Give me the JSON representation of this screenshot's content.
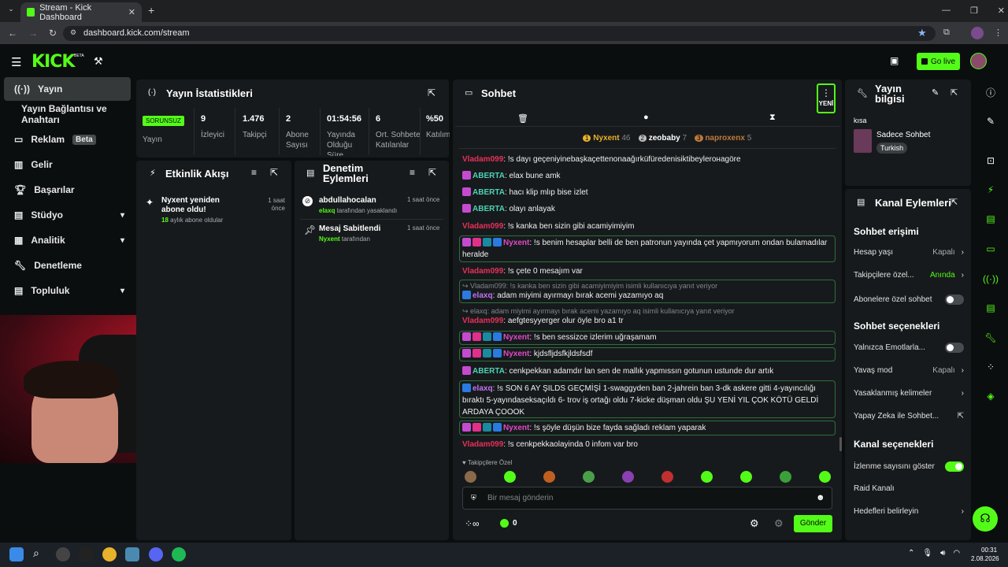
{
  "browser": {
    "tab_title": "Stream - Kick Dashboard",
    "url": "dashboard.kick.com/stream"
  },
  "header": {
    "logo": "KICK",
    "logo_badge": "BETA",
    "go_live": "Go live"
  },
  "sidebar": {
    "items": [
      {
        "label": "Yayın"
      },
      {
        "label": "Yayın Bağlantısı ve Anahtarı"
      },
      {
        "label": "Reklam",
        "badge": "Beta"
      },
      {
        "label": "Gelir"
      },
      {
        "label": "Başarılar"
      },
      {
        "label": "Stüdyo"
      },
      {
        "label": "Analitik"
      },
      {
        "label": "Denetleme"
      },
      {
        "label": "Topluluk"
      }
    ]
  },
  "stats": {
    "title": "Yayın İstatistikleri",
    "status": "SORUNSUZ",
    "status_label": "Yayın",
    "cols": [
      {
        "value": "9",
        "label": "İzleyici"
      },
      {
        "value": "1.476",
        "label": "Takipçi"
      },
      {
        "value": "2",
        "label": "Abone Sayısı"
      },
      {
        "value": "01:54:56",
        "label": "Yayında Olduğu Süre"
      },
      {
        "value": "6",
        "label": "Ort. Sohbete Katılanlar"
      },
      {
        "value": "%50",
        "label": "Katılım"
      }
    ]
  },
  "activity": {
    "title": "Etkinlik Akışı",
    "items": [
      {
        "title": "Nyxent yeniden abone oldu!",
        "sub_num": "18",
        "sub_text": "aylık abone oldular",
        "time": "1 saat önce"
      }
    ]
  },
  "mod": {
    "title": "Denetim Eylemleri",
    "items": [
      {
        "title": "abdullahocalan",
        "by": "elaxq",
        "action": "tarafından yasaklandı",
        "time": "1 saat önce"
      },
      {
        "title": "Mesaj Sabitlendi",
        "by": "Nyxent",
        "action": "tarafından",
        "time": "1 saat önce"
      }
    ]
  },
  "chat": {
    "title": "Sohbet",
    "new_badge": "YENİ",
    "leaders": [
      {
        "rank": "1",
        "name": "Nyxent",
        "count": "46"
      },
      {
        "rank": "2",
        "name": "zeobaby",
        "count": "7"
      },
      {
        "rank": "3",
        "name": "naproxenx",
        "count": "5"
      }
    ],
    "messages": [
      {
        "user": "Vladam099",
        "text": ": !s dayı geçeniyinebaşkaçettenonaağırküfüredenisiktibeylerонagöre"
      },
      {
        "user": "ABERTA",
        "text": ": elax bune amk"
      },
      {
        "user": "ABERTA",
        "text": ": hacı klip mlıp bise izlet"
      },
      {
        "user": "ABERTA",
        "text": ": olayı anlayak"
      },
      {
        "user": "Vladam099",
        "text": ": !s kanka ben sizin gibi acamiyimiyim"
      },
      {
        "user": "Nyxent",
        "text": ": !s benim hesaplar belli de ben patronun yayında çet yapmıyorum ondan bulamadılar heralde"
      },
      {
        "user": "Vladam099",
        "text": ": !s çete 0 mesajım var"
      },
      {
        "reply": "Vladam099: !s kanka ben sizin gibi acamiyimiyim isimli kullanıcıya yanıt veriyor",
        "user": "elaxq",
        "text": ": adam miyimi ayırmayı bırak acemi yazamıyo aq"
      },
      {
        "reply": "elaxq: adam miyimi ayırmayı bırak acemi yazamıyo aq isimli kullanıcıya yanıt veriyor",
        "user": "Vladam099",
        "text": ": aefgtesyyerger olur öyle bro a1 tr"
      },
      {
        "user": "Nyxent",
        "text": ": !s ben sessizce izlerim uğraşamam"
      },
      {
        "user": "Nyxent",
        "text": ": kjdsfljdsfkjldsfsdf"
      },
      {
        "user": "ABERTA",
        "text": ": cenkpekkan adamdır lan sen de mallık yapmıssın gotunun ustunde dur artık"
      },
      {
        "user": "elaxq",
        "text": ": !s SON 6 AY ŞILDS GEÇMİŞİ 1-swaggyden ban 2-jahrein ban 3-dk askere gitti 4-yayıncılığı bıraktı 5-yayındaseksaçıldı 6- trov iş ortağı oldu 7-kicke düşman oldu ŞU YENİ YIL ÇOK KÖTÜ GELDİ ARDAYA ÇOOOK"
      },
      {
        "user": "Nyxent",
        "text": ": !s şöyle düşün bize fayda sağladı reklam yaparak"
      },
      {
        "user": "Vladam099",
        "text": ": !s cenkpekkaolayinda 0 infom var bro"
      }
    ],
    "followers_only": "Takipçilere Özel",
    "input_placeholder": "Bir mesaj gönderin",
    "points": "0",
    "send": "Gönder"
  },
  "info": {
    "title": "Yayın bilgisi",
    "title_value": "kısa",
    "category": "Sadece Sohbet",
    "tag": "Turkish"
  },
  "channel": {
    "title": "Kanal Eylemleri",
    "chat_access": "Sohbet erişimi",
    "account_age": "Hesap yaşı",
    "account_age_val": "Kapalı",
    "followers": "Takipçilere özel...",
    "followers_val": "Anında",
    "subs": "Abonelere özel sohbet",
    "chat_options": "Sohbet seçenekleri",
    "emotes_only": "Yalnızca Emotlarla...",
    "slow": "Yavaş mod",
    "slow_val": "Kapalı",
    "banned_words": "Yasaklanmış kelimeler",
    "ai": "Yapay Zeka ile Sohbet...",
    "channel_options": "Kanal seçenekleri",
    "view_count": "İzlenme sayısını göster",
    "raid": "Raid Kanalı",
    "goals": "Hedefleri belirleyin"
  },
  "taskbar": {
    "time": "00:31",
    "date": "2.08.2026"
  }
}
